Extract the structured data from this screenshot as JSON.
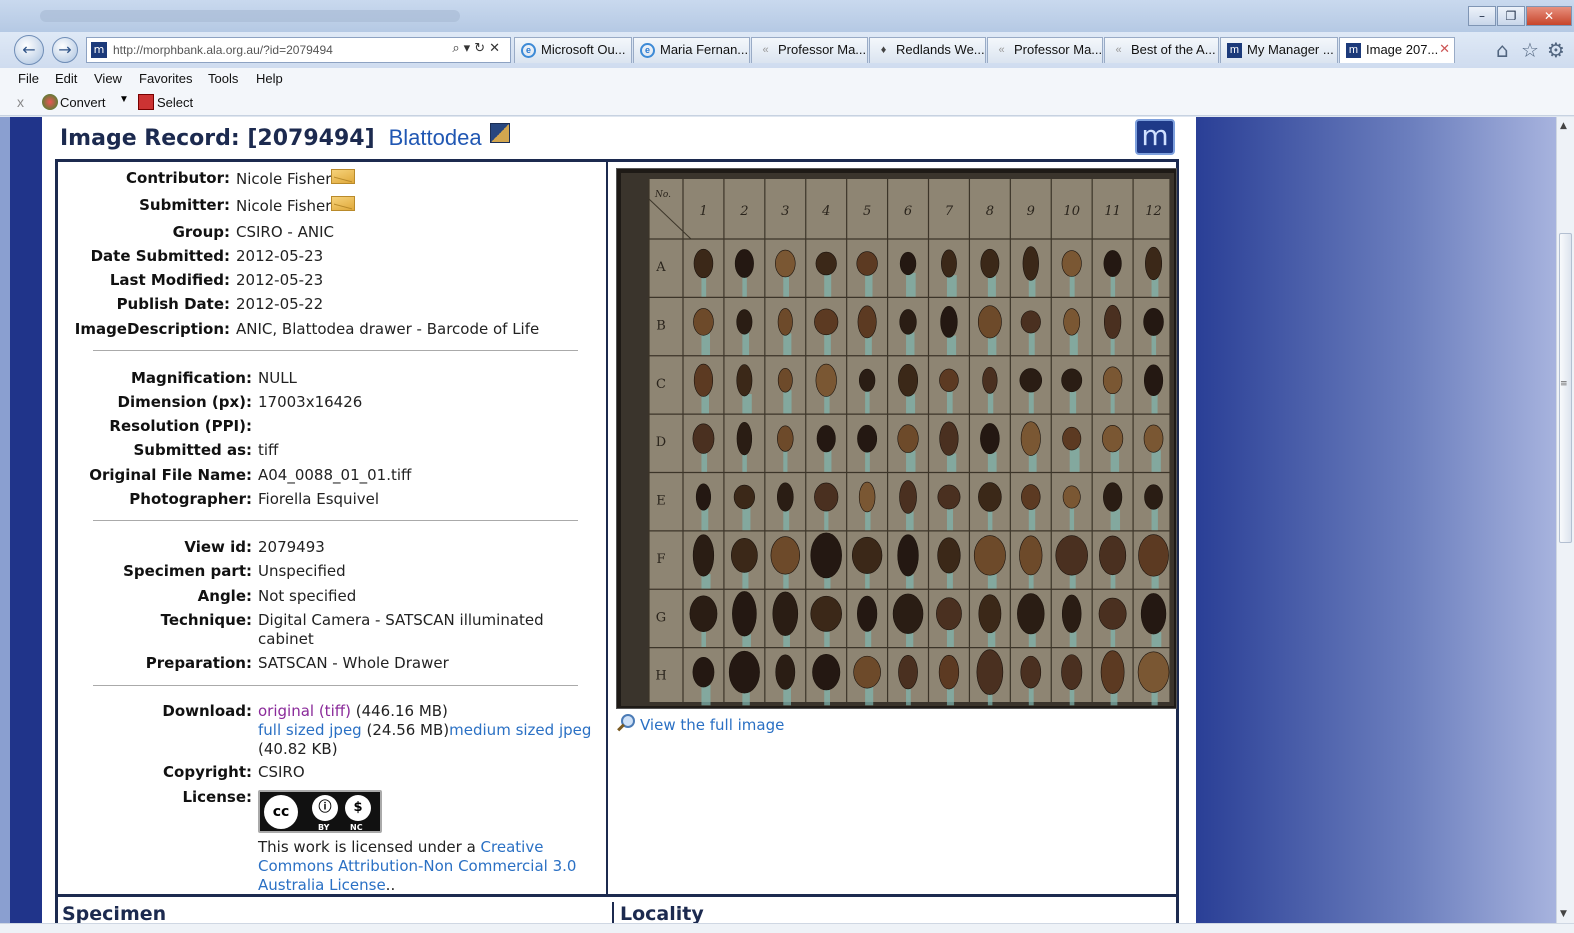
{
  "browser": {
    "address": "http://morphbank.ala.org.au/?id=2079494",
    "tabs": [
      {
        "label": "Microsoft Ou...",
        "icon": "ie-icon"
      },
      {
        "label": "Maria Fernan...",
        "icon": "ie-icon"
      },
      {
        "label": "Professor Ma...",
        "icon": "twitter-icon"
      },
      {
        "label": "Redlands We...",
        "icon": "redlands-icon"
      },
      {
        "label": "Professor Ma...",
        "icon": "twitter-icon"
      },
      {
        "label": "Best of the A...",
        "icon": "twitter-icon"
      },
      {
        "label": "My Manager ...",
        "icon": "morphbank-icon"
      },
      {
        "label": "Image 207...",
        "icon": "morphbank-icon",
        "active": true
      }
    ],
    "menu": [
      "File",
      "Edit",
      "View",
      "Favorites",
      "Tools",
      "Help"
    ],
    "command_bar": {
      "close": "x",
      "convert": "Convert",
      "select": "Select"
    }
  },
  "record": {
    "title": "Image Record: [2079494]",
    "taxon": "Blattodea",
    "meta": [
      {
        "label": "Contributor:",
        "value": "Nicole Fisher",
        "link": true,
        "mail": true
      },
      {
        "label": "Submitter:",
        "value": "Nicole Fisher",
        "link": true,
        "mail": true
      },
      {
        "label": "Group:",
        "value": "CSIRO - ANIC",
        "link": true
      },
      {
        "label": "Date Submitted:",
        "value": "2012-05-23"
      },
      {
        "label": "Last Modified:",
        "value": "2012-05-23"
      },
      {
        "label": "Publish Date:",
        "value": "2012-05-22"
      },
      {
        "label": "ImageDescription:",
        "value": "ANIC, Blattodea drawer - Barcode of Life"
      }
    ],
    "tech": [
      {
        "label": "Magnification:",
        "value": "NULL"
      },
      {
        "label": "Dimension (px):",
        "value": "17003x16426"
      },
      {
        "label": "Resolution (PPI):",
        "value": ""
      },
      {
        "label": "Submitted as:",
        "value": "tiff"
      },
      {
        "label": "Original File Name:",
        "value": "A04_0088_01_01.tiff"
      },
      {
        "label": "Photographer:",
        "value": "Fiorella Esquivel"
      }
    ],
    "view": [
      {
        "label": "View id:",
        "value": "2079493",
        "link": true
      },
      {
        "label": "Specimen part:",
        "value": "Unspecified"
      },
      {
        "label": "Angle:",
        "value": "Not specified"
      },
      {
        "label": "Technique:",
        "value": "Digital Camera - SATSCAN illuminated cabinet"
      },
      {
        "label": "Preparation:",
        "value": "SATSCAN - Whole Drawer"
      }
    ],
    "download": {
      "label": "Download:",
      "original": "original (tiff)",
      "original_size": "(446.16 MB)",
      "full_jpeg": "full sized jpeg",
      "full_size": "(24.56 MB)",
      "medium_jpeg": "medium sized jpeg",
      "medium_size": "(40.82 KB)"
    },
    "copyright": {
      "label": "Copyright:",
      "value": "CSIRO"
    },
    "license": {
      "label": "License:",
      "badge_cc": "cc",
      "badge_by": "BY",
      "badge_nc": "NC",
      "text_prefix": "This work is licensed under a ",
      "link_text": "Creative Commons Attribution-Non Commercial 3.0 Australia License",
      "text_suffix": ".."
    },
    "image": {
      "columns": [
        "No.",
        "1",
        "2",
        "3",
        "4",
        "5",
        "6",
        "7",
        "8",
        "9",
        "10",
        "11",
        "12"
      ],
      "rows": [
        "A",
        "B",
        "C",
        "D",
        "E",
        "F",
        "G",
        "H"
      ]
    },
    "view_full_image": "View the full image",
    "specimen_heading": "Specimen",
    "locality_heading": "Locality"
  },
  "colors": {
    "accent": "#2a70c4",
    "heading": "#1c2a4f",
    "page_bg": "#20348a"
  }
}
